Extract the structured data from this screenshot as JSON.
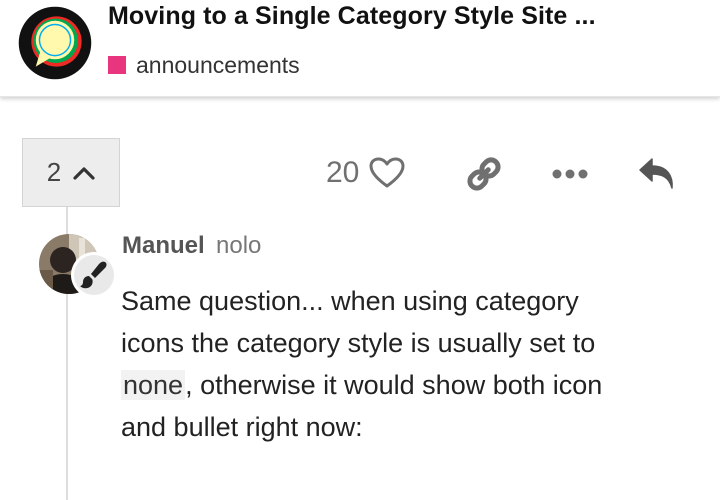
{
  "header": {
    "topic_title": "Moving to a Single Category Style Site ...",
    "category": {
      "name": "announcements",
      "color": "#e8357e"
    }
  },
  "post_controls": {
    "reply_count": "2",
    "like_count": "20"
  },
  "reply_post": {
    "username": "Manuel",
    "user_title": "nolo",
    "body_before_code": "Same question... when using category icons the category style is usually set to ",
    "body_code": "none",
    "body_after_code": ", otherwise it would show both icon and bullet right now:"
  },
  "icons": {
    "logo": "discourse-logo-icon",
    "reply_toggle": "chevron-up-icon",
    "like": "heart-icon",
    "link": "link-icon",
    "more": "ellipsis-icon",
    "reply": "reply-icon",
    "flair": "paintbrush-icon"
  },
  "colors": {
    "accent_pink": "#e8357e",
    "muted_icon": "#707070"
  }
}
